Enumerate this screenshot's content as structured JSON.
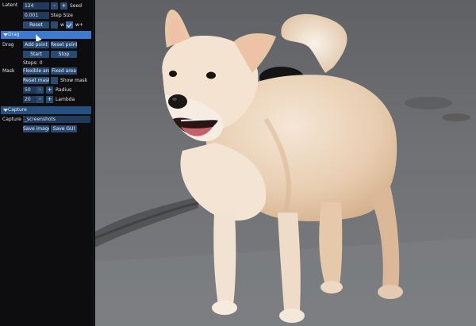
{
  "panel": {
    "latent": {
      "label": "Latent",
      "seed_value": "124",
      "seed_label": "Seed",
      "minus": "-",
      "plus": "+",
      "step_size_value": "0.001",
      "step_size_label": "Step Size",
      "reset_label": "Reset",
      "w_label": "w",
      "wplus_label": "w+"
    },
    "drag_section": {
      "title": "Drag",
      "drag_label": "Drag",
      "add_point": "Add point",
      "reset_point": "Reset point",
      "start": "Start",
      "stop": "Stop",
      "steps_label": "Steps: 0",
      "mask_label": "Mask",
      "flexible_area": "Flexible area",
      "fixed_area": "Fixed area",
      "reset_mask": "Reset mask",
      "show_mask": "Show mask",
      "radius_value": "50",
      "radius_label": "Radius",
      "lambda_value": "20",
      "lambda_label": "Lambda",
      "minus": "-",
      "plus": "+"
    },
    "capture_section": {
      "title": "Capture",
      "capture_label": "Capture",
      "path_value": "_screenshots",
      "save_image": "Save image",
      "save_gui": "Save GUI"
    }
  },
  "colors": {
    "panel_bg": "#0d0d10",
    "button": "#2a4a72",
    "header_active": "#3d7bd0",
    "header_inactive": "#28507e"
  },
  "canvas": {
    "subject": "dog photo"
  }
}
